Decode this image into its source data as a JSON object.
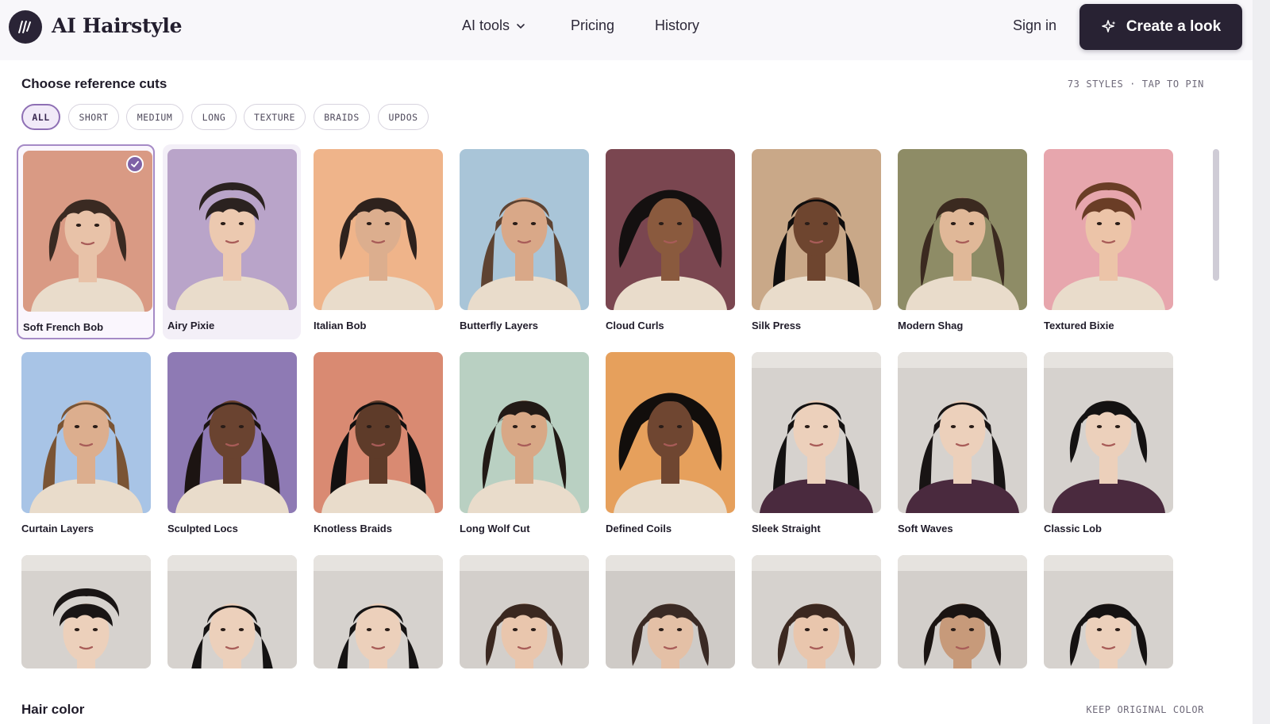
{
  "header": {
    "brand": "AI Hairstyle",
    "nav": [
      {
        "label": "AI tools",
        "has_dropdown": true
      },
      {
        "label": "Pricing"
      },
      {
        "label": "History"
      }
    ],
    "sign_in": "Sign in",
    "cta": "Create a look"
  },
  "reference": {
    "title": "Choose reference cuts",
    "meta": "73 STYLES · TAP TO PIN",
    "filters": [
      {
        "label": "ALL",
        "active": true
      },
      {
        "label": "SHORT"
      },
      {
        "label": "MEDIUM"
      },
      {
        "label": "LONG"
      },
      {
        "label": "TEXTURE"
      },
      {
        "label": "BRAIDS"
      },
      {
        "label": "UPDOS"
      }
    ],
    "styles": [
      {
        "label": "Soft French Bob",
        "selected": true,
        "bg": "#d99a84",
        "hair": "#3a2a22",
        "skin": "#e8c2a8",
        "shape": "bob"
      },
      {
        "label": "Airy Pixie",
        "bg": "#b9a4c9",
        "hair": "#2b2220",
        "skin": "#ecc9b0",
        "shape": "pixie"
      },
      {
        "label": "Italian Bob",
        "bg": "#efb48a",
        "hair": "#2e221d",
        "skin": "#dcae8e",
        "shape": "bob"
      },
      {
        "label": "Butterfly Layers",
        "bg": "#a9c5d8",
        "hair": "#5e4332",
        "skin": "#d9a888",
        "shape": "long"
      },
      {
        "label": "Cloud Curls",
        "bg": "#7a4650",
        "hair": "#141010",
        "skin": "#8a5a3e",
        "shape": "curls"
      },
      {
        "label": "Silk Press",
        "bg": "#c9a888",
        "hair": "#0f0d0d",
        "skin": "#6e452f",
        "shape": "straight"
      },
      {
        "label": "Modern Shag",
        "bg": "#8e8c66",
        "hair": "#3b2a20",
        "skin": "#e0b898",
        "shape": "shag"
      },
      {
        "label": "Textured Bixie",
        "bg": "#e7a6ad",
        "hair": "#6a3d26",
        "skin": "#ecc4a8",
        "shape": "pixie"
      },
      {
        "label": "Curtain Layers",
        "bg": "#a8c4e6",
        "hair": "#7a5434",
        "skin": "#dcae8e",
        "shape": "long"
      },
      {
        "label": "Sculpted Locs",
        "bg": "#8e7ab4",
        "hair": "#1c1412",
        "skin": "#6a4330",
        "shape": "locs"
      },
      {
        "label": "Knotless Braids",
        "bg": "#d98a72",
        "hair": "#121010",
        "skin": "#5e3b29",
        "shape": "braids"
      },
      {
        "label": "Long Wolf Cut",
        "bg": "#b9d0c2",
        "hair": "#221a16",
        "skin": "#d8a886",
        "shape": "shag"
      },
      {
        "label": "Defined Coils",
        "bg": "#e6a05c",
        "hair": "#120e0c",
        "skin": "#6f4631",
        "shape": "curls"
      },
      {
        "label": "Sleek Straight",
        "bg": "#d6d2ce",
        "hair": "#141212",
        "skin": "#ecd0bb",
        "shape": "straight"
      },
      {
        "label": "Soft Waves",
        "bg": "#d6d2ce",
        "hair": "#181414",
        "skin": "#ecd0bb",
        "shape": "long"
      },
      {
        "label": "Classic Lob",
        "bg": "#d6d2ce",
        "hair": "#141212",
        "skin": "#ecd0bb",
        "shape": "bob"
      },
      {
        "label": "",
        "bg": "#d6d2ce",
        "hair": "#191515",
        "skin": "#ecd0bb",
        "shape": "pixie"
      },
      {
        "label": "",
        "bg": "#d6d2ce",
        "hair": "#141212",
        "skin": "#ecd0bb",
        "shape": "long"
      },
      {
        "label": "",
        "bg": "#d6d2ce",
        "hair": "#151313",
        "skin": "#ecd0bb",
        "shape": "long"
      },
      {
        "label": "",
        "bg": "#d3cfcb",
        "hair": "#3a2820",
        "skin": "#e9c6ad",
        "shape": "bob"
      },
      {
        "label": "",
        "bg": "#cfcbc7",
        "hair": "#3a2a24",
        "skin": "#e4c0a6",
        "shape": "bob"
      },
      {
        "label": "",
        "bg": "#d6d2ce",
        "hair": "#3b2820",
        "skin": "#e9c6ad",
        "shape": "bob"
      },
      {
        "label": "",
        "bg": "#d3cfcb",
        "hair": "#1a1412",
        "skin": "#c79a7a",
        "shape": "bob"
      },
      {
        "label": "",
        "bg": "#d6d2ce",
        "hair": "#151212",
        "skin": "#ecd0bb",
        "shape": "bob"
      }
    ]
  },
  "hair_color": {
    "title": "Hair color",
    "meta": "KEEP ORIGINAL COLOR"
  },
  "colors": {
    "accent": "#7e62a6",
    "cta_bg": "#282233"
  }
}
